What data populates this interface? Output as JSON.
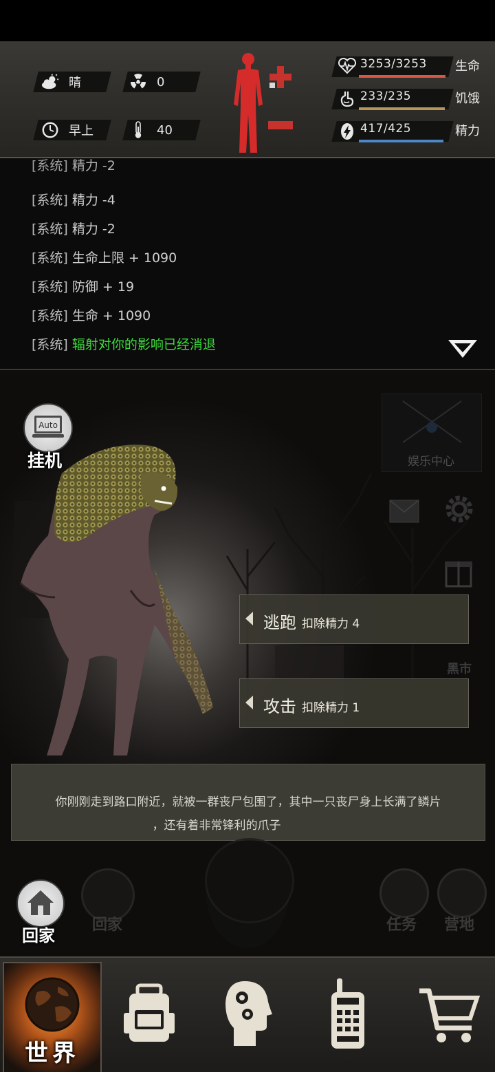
{
  "hud": {
    "weather": {
      "icon": "sunny-cloud-icon",
      "label": "晴"
    },
    "radiation": {
      "icon": "radiation-icon",
      "value": "0"
    },
    "time": {
      "icon": "clock-icon",
      "label": "早上"
    },
    "temperature": {
      "icon": "thermometer-icon",
      "value": "40"
    },
    "body_status": {
      "icon": "human-body-icon",
      "color": "#d62b2b"
    },
    "stats": [
      {
        "key": "health",
        "icon": "heart-pulse-icon",
        "value": "3253/3253",
        "label": "生命",
        "fill": 1.0,
        "color": "#d95745"
      },
      {
        "key": "hunger",
        "icon": "stomach-icon",
        "value": "233/235",
        "label": "饥饿",
        "fill": 0.99,
        "color": "#b9955a"
      },
      {
        "key": "energy",
        "icon": "lightning-icon",
        "value": "417/425",
        "label": "精力",
        "fill": 0.98,
        "color": "#4f86c6"
      }
    ]
  },
  "log": {
    "lines": [
      {
        "tag": "[系统]",
        "msg": "精力 -2",
        "green": false,
        "partial": true
      },
      {
        "tag": "[系统]",
        "msg": "精力 -4",
        "green": false
      },
      {
        "tag": "[系统]",
        "msg": "精力 -2",
        "green": false
      },
      {
        "tag": "[系统]",
        "msg": "生命上限 + 1090",
        "green": false
      },
      {
        "tag": "[系统]",
        "msg": "防御 + 19",
        "green": false
      },
      {
        "tag": "[系统]",
        "msg": "生命 + 1090",
        "green": false
      },
      {
        "tag": "[系统]",
        "msg": "辐射对你的影响已经消退",
        "green": true
      }
    ],
    "toggle_icon": "chevron-down-icon"
  },
  "scene": {
    "auto_button": {
      "icon": "auto-monitor-icon",
      "icon_text": "Auto",
      "label": "挂机"
    },
    "entertainment": {
      "label": "娱乐中心"
    },
    "faded": {
      "black_market": "黑市",
      "home": "回家",
      "task": "任务",
      "camp": "营地"
    },
    "actions": [
      {
        "name": "逃跑",
        "cost": "扣除精力 4"
      },
      {
        "name": "攻击",
        "cost": "扣除精力 1"
      }
    ],
    "narrative": [
      "你刚刚走到路口附近，就被一群丧尸包围了，其中一只丧尸身上长满了鳞片",
      "，还有着非常锋利的爪子"
    ],
    "home_button": {
      "icon": "house-icon",
      "label": "回家"
    }
  },
  "nav": {
    "items": [
      {
        "name": "world",
        "icon": "globe-icon",
        "label": "世界",
        "active": true
      },
      {
        "name": "backpack",
        "icon": "backpack-icon"
      },
      {
        "name": "skills",
        "icon": "head-gears-icon"
      },
      {
        "name": "radio",
        "icon": "walkie-talkie-icon"
      },
      {
        "name": "shop",
        "icon": "shopping-cart-icon"
      }
    ]
  }
}
